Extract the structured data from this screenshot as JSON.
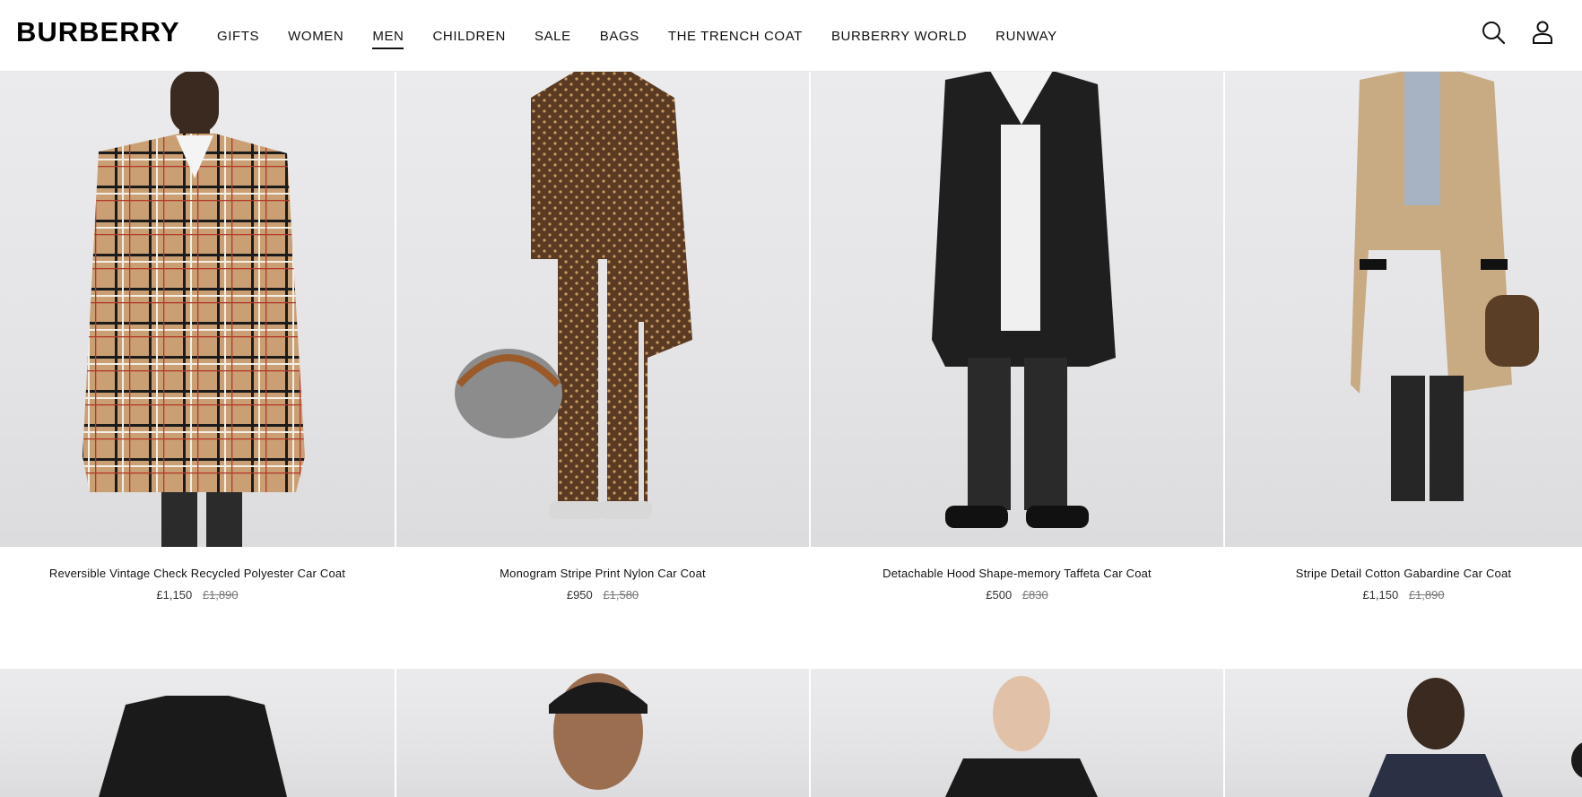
{
  "brand": "BURBERRY",
  "nav": [
    {
      "label": "GIFTS"
    },
    {
      "label": "WOMEN"
    },
    {
      "label": "MEN",
      "active": true
    },
    {
      "label": "CHILDREN"
    },
    {
      "label": "SALE"
    },
    {
      "label": "BAGS"
    },
    {
      "label": "THE TRENCH COAT"
    },
    {
      "label": "BURBERRY WORLD"
    },
    {
      "label": "RUNWAY"
    }
  ],
  "header_icons": [
    "search-icon",
    "account-icon"
  ],
  "products": [
    {
      "name": "Reversible Vintage Check Recycled Polyester Car Coat",
      "price": "£1,150",
      "original_price": "£1,890",
      "image": "check-car-coat"
    },
    {
      "name": "Monogram Stripe Print Nylon Car Coat",
      "price": "£950",
      "original_price": "£1,580",
      "image": "monogram-car-coat"
    },
    {
      "name": "Detachable Hood Shape-memory Taffeta Car Coat",
      "price": "£500",
      "original_price": "£830",
      "image": "black-hooded-coat"
    },
    {
      "name": "Stripe Detail Cotton Gabardine Car Coat",
      "price": "£1,150",
      "original_price": "£1,890",
      "image": "beige-gabardine-coat"
    }
  ],
  "colors": {
    "text": "#111111",
    "divider": "#e7e7e7",
    "photo_bg": "#e8e8ea"
  }
}
